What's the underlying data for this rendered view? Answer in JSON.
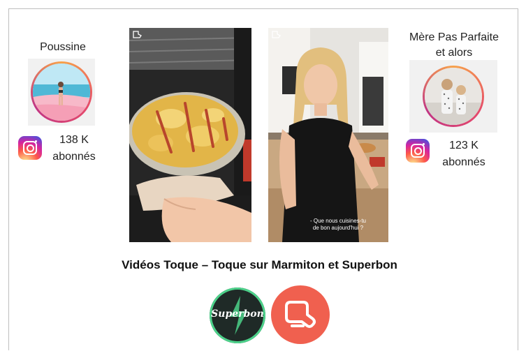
{
  "left_influencer": {
    "name": "Poussine",
    "followers": "138 K",
    "followers_label": "abonnés",
    "icon": "instagram-icon"
  },
  "right_influencer": {
    "name_line1": "Mère Pas Parfaite",
    "name_line2": "et alors",
    "followers": "123 K",
    "followers_label": "abonnés",
    "icon": "instagram-icon"
  },
  "video_right": {
    "caption_line1": "- Que nous cuisines-tu",
    "caption_line2": "de bon aujourd'hui ?"
  },
  "headline": "Vidéos Toque – Toque sur Marmiton et Superbon",
  "logos": {
    "superbon_text": "Superbon",
    "marmiton_icon": "oven-mitt-icon"
  },
  "colors": {
    "superbon_bg": "#1f2a27",
    "superbon_ring": "#4cd18a",
    "marmiton_bg": "#f0604f"
  }
}
